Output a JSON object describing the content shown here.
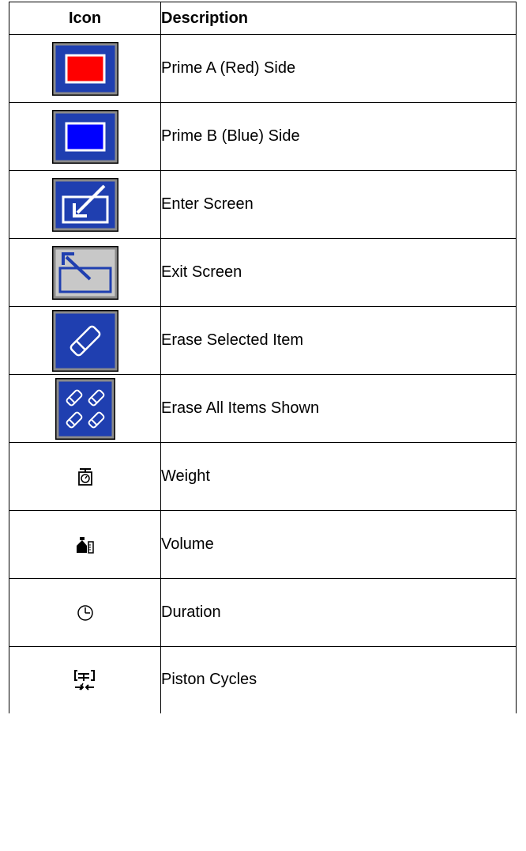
{
  "header": {
    "icon": "Icon",
    "description": "Description"
  },
  "rows": [
    {
      "icon": "prime-a-red-icon",
      "label": "Prime A (Red) Side"
    },
    {
      "icon": "prime-b-blue-icon",
      "label": "Prime B (Blue) Side"
    },
    {
      "icon": "enter-screen-icon",
      "label": "Enter Screen"
    },
    {
      "icon": "exit-screen-icon",
      "label": "Exit Screen"
    },
    {
      "icon": "erase-selected-icon",
      "label": "Erase Selected Item"
    },
    {
      "icon": "erase-all-icon",
      "label": "Erase All Items Shown"
    },
    {
      "icon": "weight-icon",
      "label": "Weight"
    },
    {
      "icon": "volume-icon",
      "label": "Volume"
    },
    {
      "icon": "duration-icon",
      "label": "Duration"
    },
    {
      "icon": "piston-cycles-icon",
      "label": "Piston Cycles"
    }
  ],
  "colors": {
    "button_blue": "#1f3fb0",
    "red_fill": "#ff0000",
    "blue_fill": "#0000ff",
    "bevel_gray": "#8a8a8a",
    "light_gray": "#c8c8c8"
  }
}
